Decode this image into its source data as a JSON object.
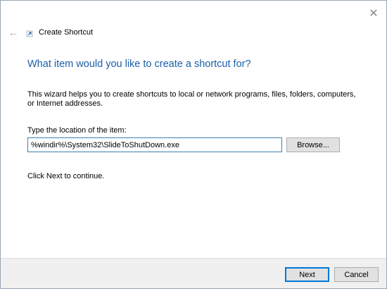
{
  "window": {
    "title": "Create Shortcut",
    "close_glyph": "✕",
    "back_glyph": "←"
  },
  "content": {
    "heading": "What item would you like to create a shortcut for?",
    "description": "This wizard helps you to create shortcuts to local or network programs, files, folders, computers, or Internet addresses.",
    "location_label": "Type the location of the item:",
    "location_value": "%windir%\\System32\\SlideToShutDown.exe",
    "browse_label": "Browse...",
    "continue_text": "Click Next to continue."
  },
  "footer": {
    "next_label": "Next",
    "cancel_label": "Cancel"
  },
  "colors": {
    "heading": "#1a5fa8",
    "accent": "#0078d7",
    "footer_bg": "#f0f0f0"
  },
  "icons": {
    "close": "close-icon",
    "back": "back-arrow-icon",
    "title": "shortcut-icon"
  }
}
